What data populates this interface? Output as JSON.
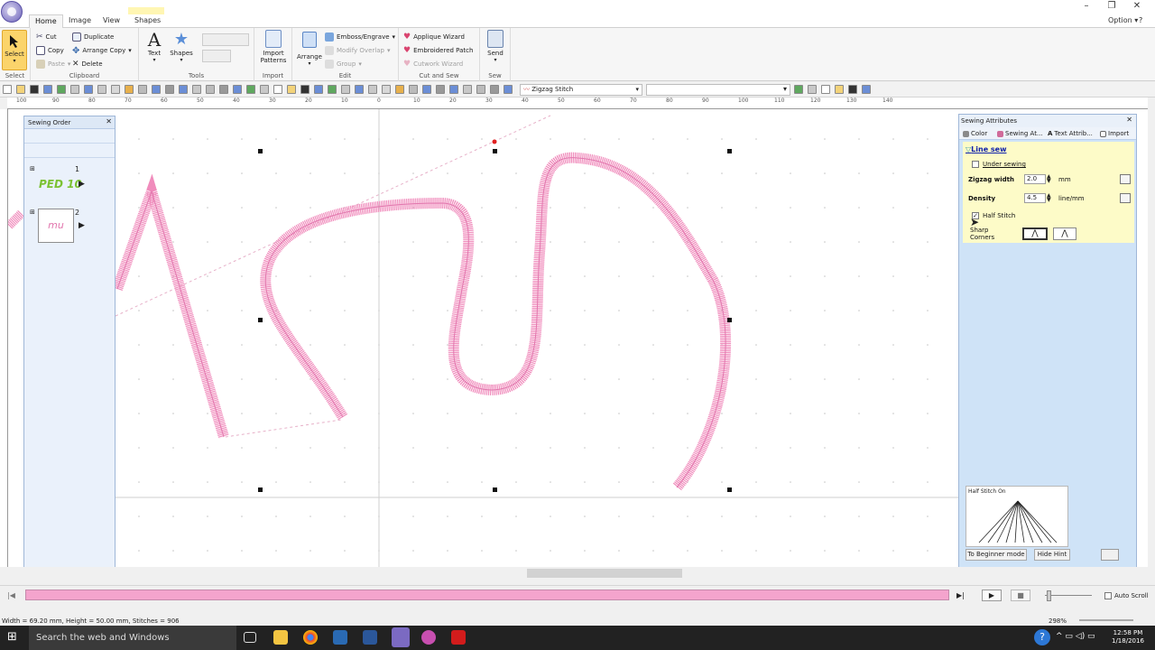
{
  "window": {
    "option_label": "Option"
  },
  "tabs": [
    {
      "label": "Home",
      "active": true
    },
    {
      "label": "Image",
      "active": false
    },
    {
      "label": "View",
      "active": false
    },
    {
      "label": "Shapes",
      "active": false
    }
  ],
  "ribbon": {
    "select": {
      "label": "Select",
      "group": "Select"
    },
    "clipboard": {
      "group": "Clipboard",
      "cut": "Cut",
      "copy": "Copy",
      "paste": "Paste",
      "duplicate": "Duplicate",
      "arrange_copy": "Arrange Copy",
      "delete": "Delete"
    },
    "tools": {
      "group": "Tools",
      "text": "Text",
      "shapes": "Shapes"
    },
    "import": {
      "group": "Import",
      "import_patterns": "Import",
      "import_patterns2": "Patterns"
    },
    "edit": {
      "group": "Edit",
      "arrange": "Arrange",
      "emboss": "Emboss/Engrave",
      "modify_overlap": "Modify Overlap",
      "group_btn": "Group"
    },
    "cutsew": {
      "group": "Cut and Sew",
      "applique": "Applique Wizard",
      "embroidered_patch": "Embroidered Patch",
      "cutwork": "Cutwork Wizard"
    },
    "sew": {
      "group": "Sew",
      "send": "Send"
    }
  },
  "toolbar": {
    "stitch_type": "Zigzag Stitch"
  },
  "ruler": {
    "h_ticks": [
      "140",
      "130",
      "120",
      "110",
      "100",
      "90",
      "80",
      "70",
      "60",
      "50",
      "40",
      "30",
      "20",
      "10",
      "0",
      "10",
      "20",
      "30",
      "40",
      "50",
      "60",
      "70",
      "80",
      "90",
      "100",
      "110",
      "120",
      "130",
      "140"
    ]
  },
  "sewing_order": {
    "title": "Sewing Order",
    "items": [
      {
        "number": "1",
        "preview_text": "PED 10"
      },
      {
        "number": "2",
        "preview_text": "mu"
      }
    ]
  },
  "attributes": {
    "title": "Sewing Attributes",
    "tabs": [
      "Color",
      "Sewing At...",
      "Text Attrib...",
      "Import"
    ],
    "section": "Line sew",
    "under_sewing": "Under sewing",
    "zigzag_width_label": "Zigzag width",
    "zigzag_width_value": "2.0",
    "zigzag_width_unit": "mm",
    "density_label": "Density",
    "density_value": "4.5",
    "density_unit": "line/mm",
    "half_stitch": "Half Stitch",
    "sharp_corners_label": "Sharp Corners",
    "hint_title": "Half Stitch On",
    "beginner_btn": "To Beginner mode",
    "hide_hint_btn": "Hide Hint"
  },
  "playback": {
    "auto_scroll": "Auto Scroll"
  },
  "status": {
    "info": "Width = 69.20 mm, Height = 50.00 mm, Stitches = 906",
    "zoom": "298%"
  },
  "taskbar": {
    "search_placeholder": "Search the web and Windows",
    "time": "12:58 PM",
    "date": "1/18/2016"
  },
  "colors": {
    "accent": "#f4a4cd",
    "stitch": "#e97fb5",
    "select_bg": "#fbd46b",
    "panel": "#cfe3f7",
    "hint_yellow": "#fdfbc8"
  }
}
